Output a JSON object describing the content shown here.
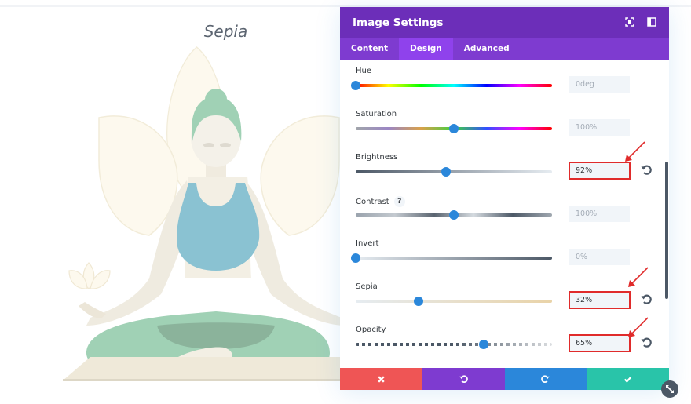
{
  "canvas": {
    "title": "Sepia"
  },
  "modal": {
    "title": "Image Settings",
    "header_icons": [
      "fullscreen-icon",
      "sidebar-layout-icon"
    ],
    "tabs": [
      {
        "label": "Content",
        "active": false
      },
      {
        "label": "Design",
        "active": true
      },
      {
        "label": "Advanced",
        "active": false
      }
    ],
    "fields": {
      "hue": {
        "label": "Hue",
        "value": "0deg",
        "position": 0.0,
        "changed": false
      },
      "saturation": {
        "label": "Saturation",
        "value": "100%",
        "position": 0.5,
        "changed": false
      },
      "brightness": {
        "label": "Brightness",
        "value": "92%",
        "position": 0.46,
        "changed": true
      },
      "contrast": {
        "label": "Contrast",
        "value": "100%",
        "position": 0.5,
        "changed": false,
        "help": "?"
      },
      "invert": {
        "label": "Invert",
        "value": "0%",
        "position": 0.0,
        "changed": false
      },
      "sepia": {
        "label": "Sepia",
        "value": "32%",
        "position": 0.32,
        "changed": true
      },
      "opacity": {
        "label": "Opacity",
        "value": "65%",
        "position": 0.65,
        "changed": true
      }
    },
    "footer": {
      "buttons": [
        {
          "name": "cancel",
          "icon": "close-icon",
          "color": "#ef5555"
        },
        {
          "name": "undo",
          "icon": "undo-icon",
          "color": "#7e3bd0"
        },
        {
          "name": "redo",
          "icon": "redo-icon",
          "color": "#2b87da"
        },
        {
          "name": "save",
          "icon": "check-icon",
          "color": "#29c4a9"
        }
      ]
    }
  },
  "colors": {
    "header": "#6c2eb9",
    "tabs": "#7e3bd0",
    "tab_active": "#8f42ec",
    "accent": "#2b87da",
    "highlight": "#e02b2b"
  }
}
